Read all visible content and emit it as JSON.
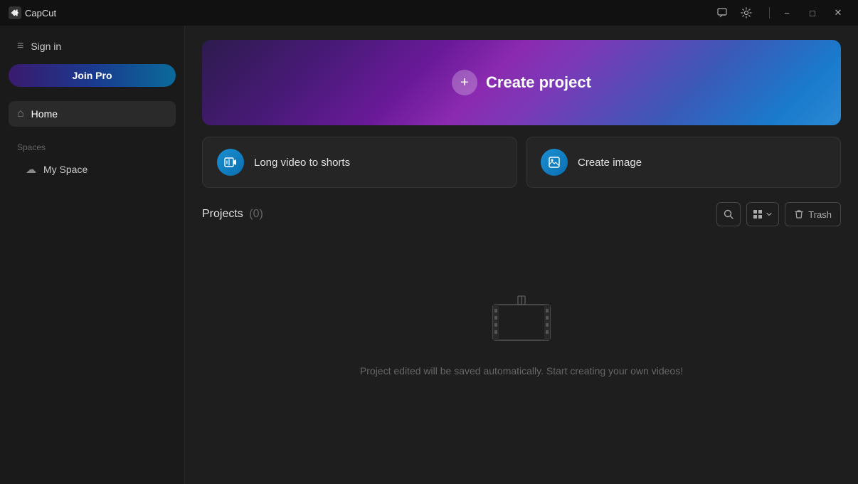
{
  "titlebar": {
    "app_name": "CapCut",
    "minimize_label": "−",
    "maximize_label": "□",
    "close_label": "✕"
  },
  "sidebar": {
    "sign_in_label": "Sign in",
    "join_pro_label": "Join Pro",
    "home_label": "Home",
    "spaces_label": "Spaces",
    "my_space_label": "My Space"
  },
  "hero": {
    "create_project_label": "Create project",
    "plus_icon": "+"
  },
  "quick_actions": [
    {
      "label": "Long video to shorts",
      "icon": "▶"
    },
    {
      "label": "Create image",
      "icon": "🖼"
    }
  ],
  "projects_section": {
    "title": "Projects",
    "count": "(0)",
    "search_tooltip": "Search",
    "trash_label": "Trash"
  },
  "empty_state": {
    "message": "Project edited will be saved automatically. Start creating your own videos!"
  }
}
